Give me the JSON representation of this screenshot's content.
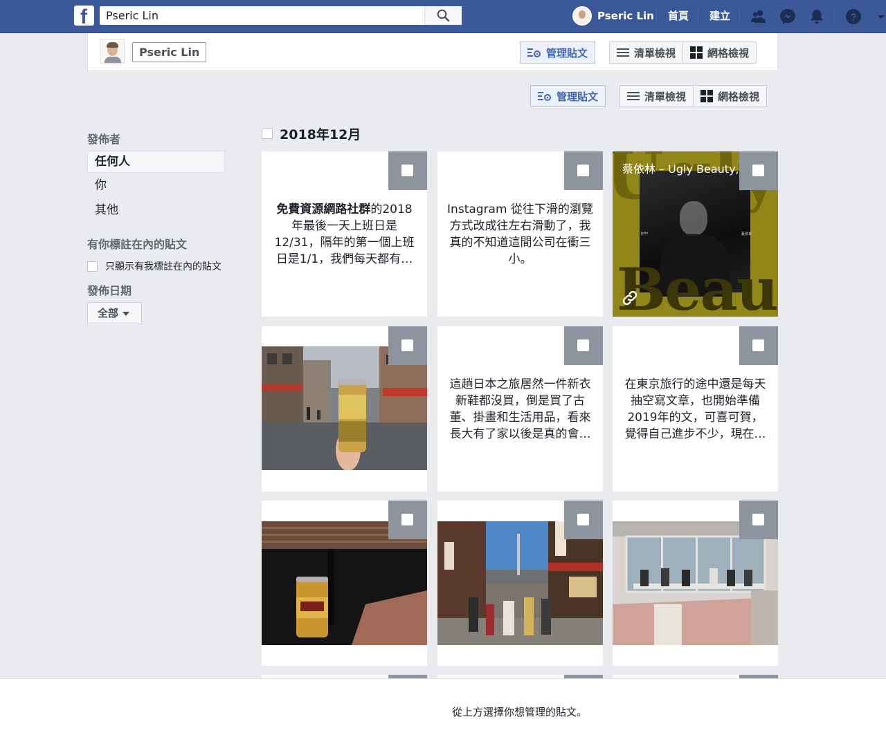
{
  "topbar": {
    "search_value": "Pseric Lin",
    "user_name": "Pseric Lin",
    "home_label": "首頁",
    "create_label": "建立"
  },
  "profile": {
    "name": "Pseric Lin"
  },
  "toolbar": {
    "manage_posts_label": "管理貼文",
    "list_view_label": "清單檢視",
    "grid_view_label": "網格檢視"
  },
  "sidebar": {
    "poster_heading": "發佈者",
    "poster_options": [
      "任何人",
      "你",
      "其他"
    ],
    "tagged_heading": "有你標註在內的貼文",
    "tagged_checkbox_label": "只顯示有我標註在內的貼文",
    "date_heading": "發佈日期",
    "date_selected": "全部"
  },
  "month_title": "2018年12月",
  "posts": [
    {
      "type": "text",
      "bold": "免費資源網路社群",
      "text": "的2018年最後一天上班日是12/31，隔年的第一個上班日是1/1，我們每天都有…"
    },
    {
      "type": "text",
      "text": "Instagram 從往下滑的瀏覽方式改成往左右滑動了，我真的不知道這間公司在衝三小。"
    },
    {
      "type": "music",
      "text": "蔡依林 – Ugly Beauty, a playlist by Pseric Lin on",
      "cover_top": "Ugly",
      "cover_bottom": "Beauty",
      "cover_small_left": "Jolin",
      "cover_small_right": "蔡依林"
    },
    {
      "type": "photo",
      "scene": "street-beer"
    },
    {
      "type": "text",
      "text": "這趟日本之旅居然一件新衣新鞋都沒買，倒是買了古董、掛畫和生活用品，看來長大有了家以後是真的會…"
    },
    {
      "type": "text",
      "text": "在東京旅行的途中還是每天抽空寫文章，也開始準備2019年的文，可喜可賀，覺得自己進步不少，現在…"
    },
    {
      "type": "photo",
      "scene": "yebisu-beer"
    },
    {
      "type": "photo",
      "scene": "shopping-street"
    },
    {
      "type": "photo",
      "scene": "cafe-window"
    }
  ],
  "bottom_hint": "從上方選擇你想管理的貼文。",
  "colors": {
    "brand_blue": "#3b5998",
    "page_bg": "#e9ebee",
    "select_box": "#8d949e",
    "link_blue": "#4267b2"
  }
}
